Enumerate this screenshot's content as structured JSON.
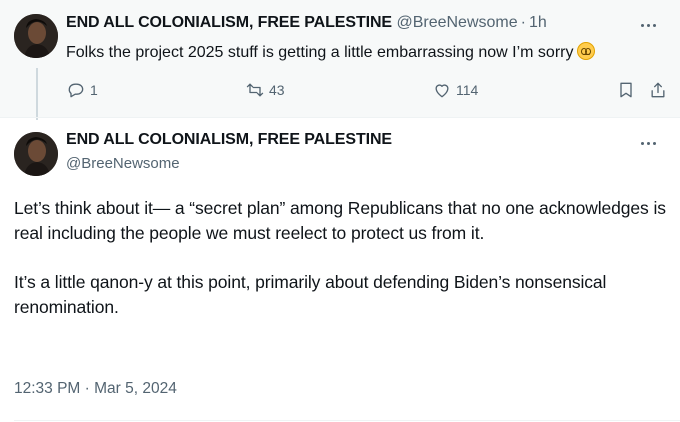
{
  "reply_tweet": {
    "display_name": "END ALL COLONIALISM, FREE PALESTINE",
    "handle": "@BreeNewsome",
    "separator": "·",
    "time_ago": "1h",
    "text": "Folks the project 2025 stuff is getting a little embarrassing now I’m sorry",
    "emoji": "woozy-face",
    "reply_count": "1",
    "retweet_count": "43",
    "like_count": "114"
  },
  "main_tweet": {
    "display_name": "END ALL COLONIALISM, FREE PALESTINE",
    "handle": "@BreeNewsome",
    "paragraph_1": "Let’s think about it— a “secret plan” among Republicans that no one acknowledges is real including the people we must reelect to protect us from it.",
    "paragraph_2": "It’s a little qanon-y at this point, primarily about defending Biden’s nonsensical renomination.",
    "timestamp": "12:33 PM · Mar 5, 2024"
  },
  "colors": {
    "text": "#0f1419",
    "muted": "#536471",
    "reply_background": "#f7f9f9"
  }
}
